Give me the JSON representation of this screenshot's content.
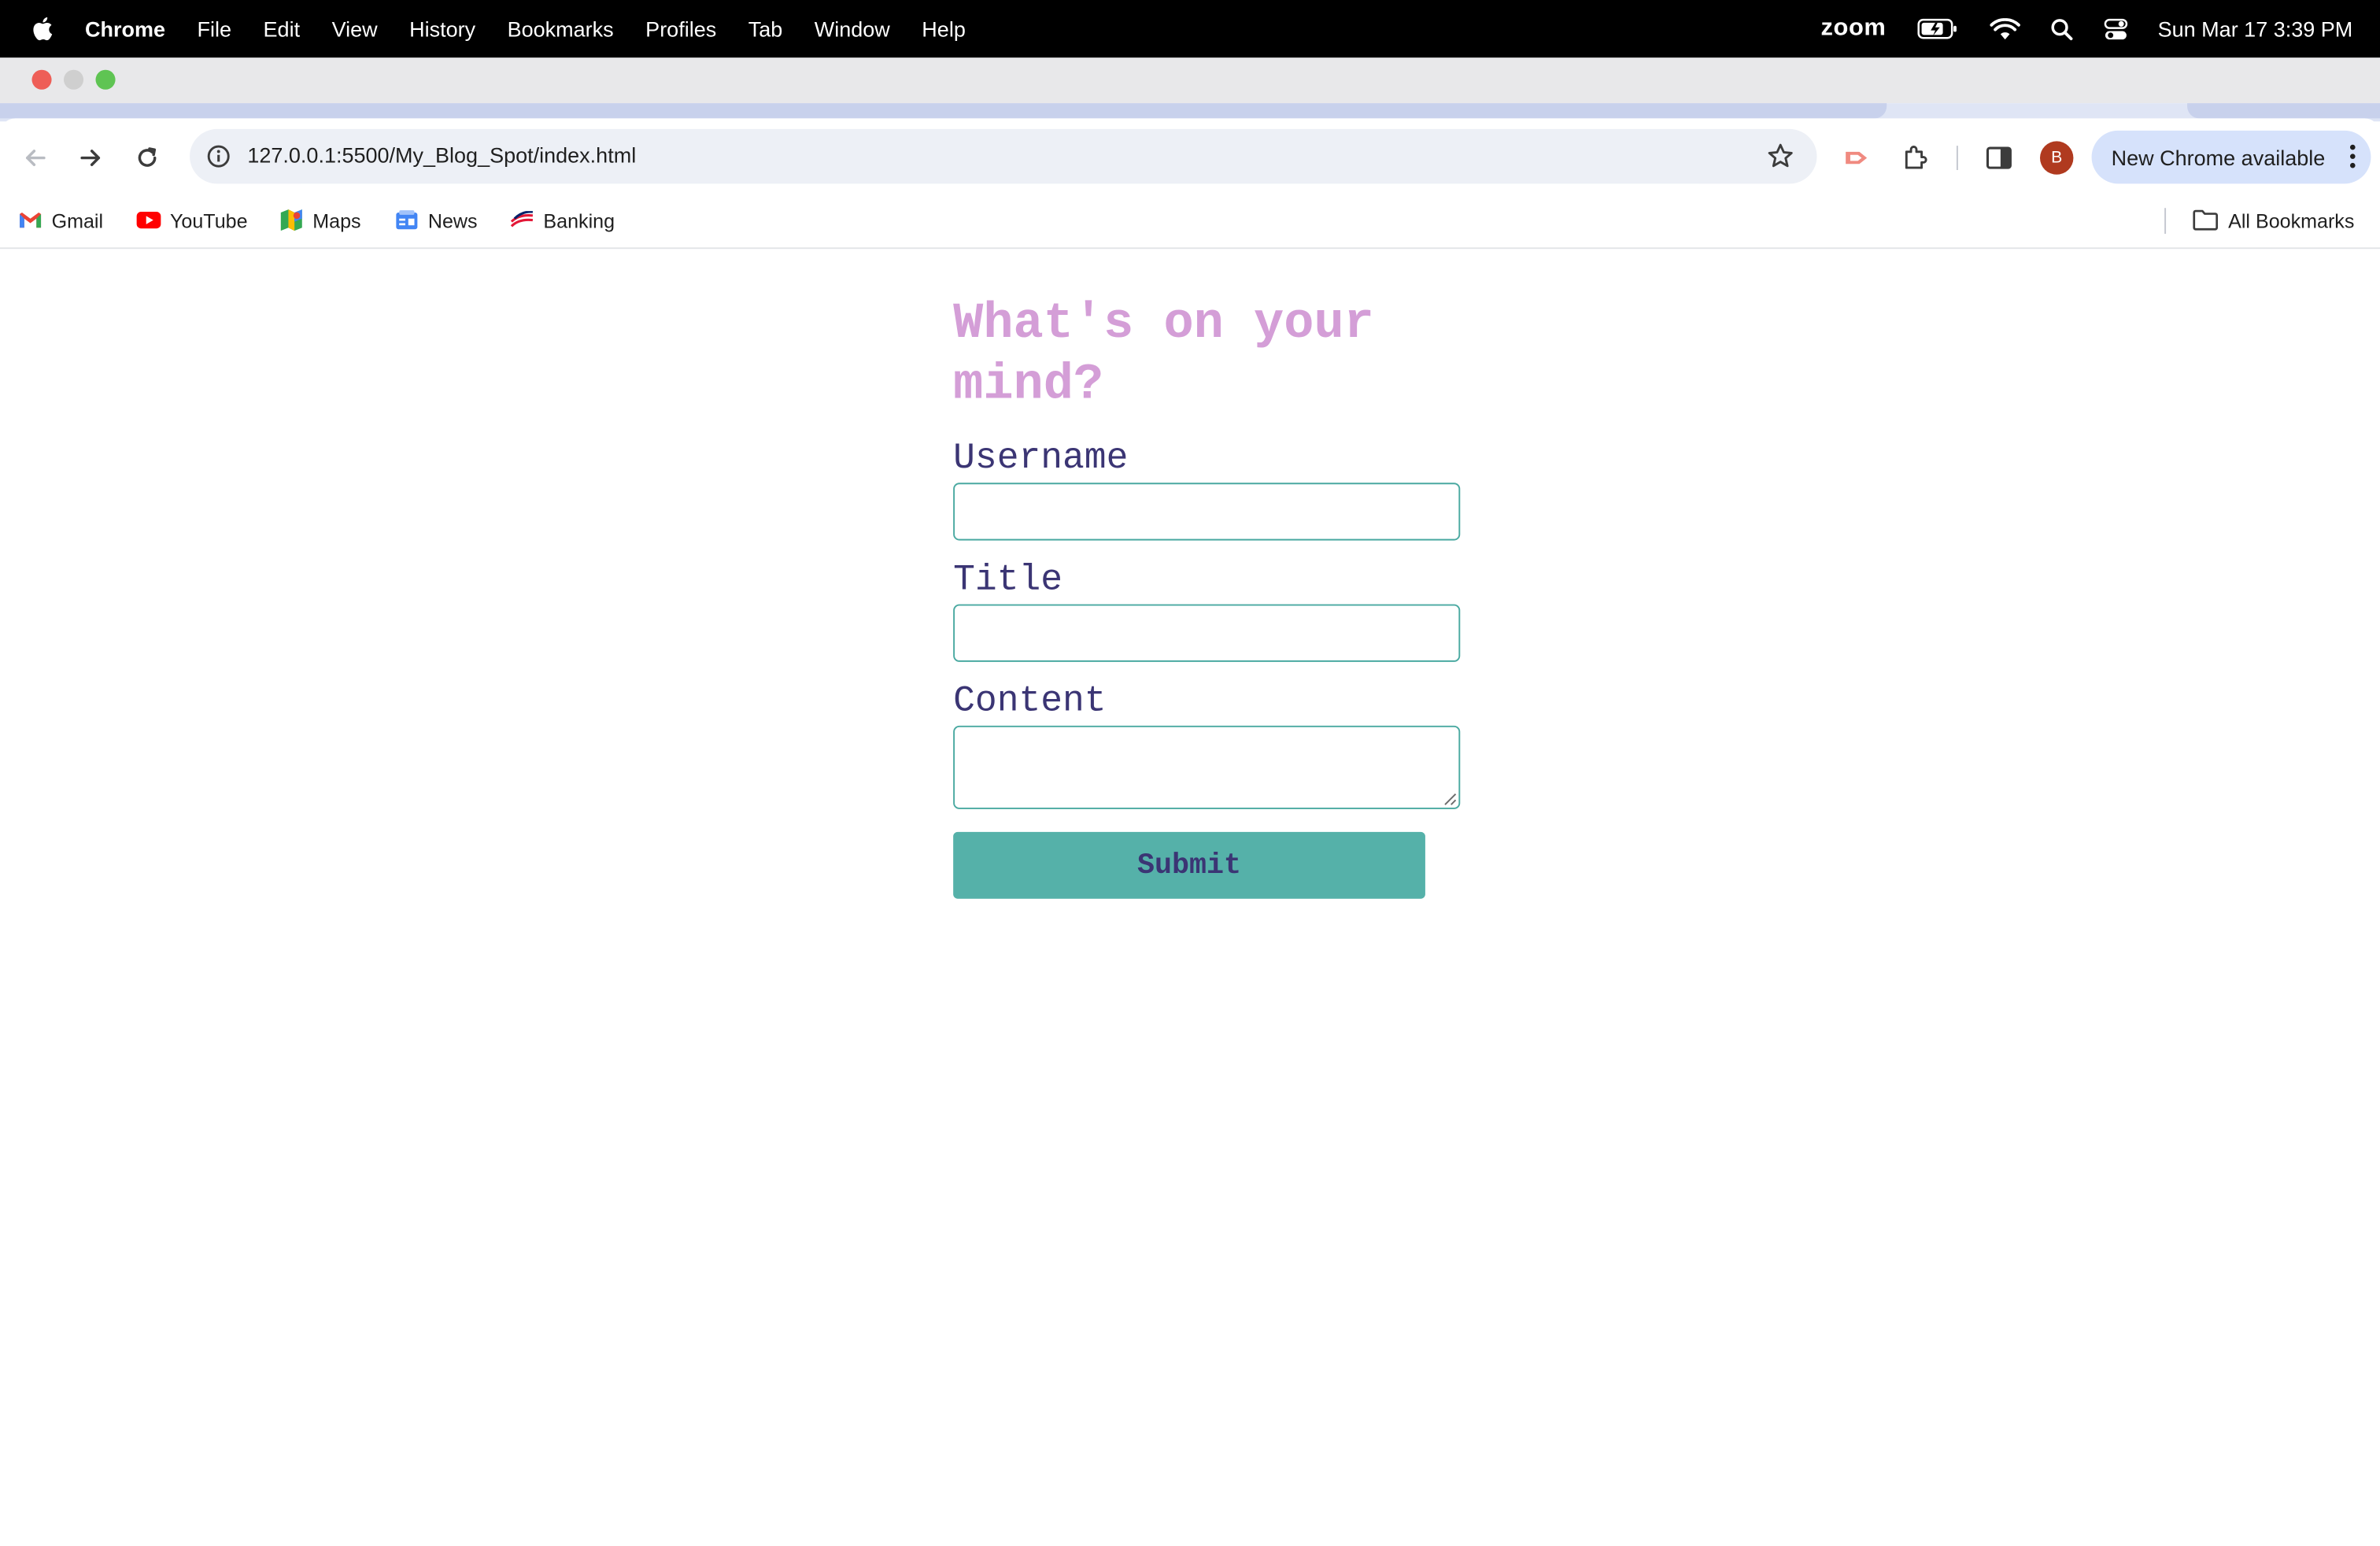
{
  "menubar": {
    "app_name": "Chrome",
    "menus": [
      "File",
      "Edit",
      "View",
      "History",
      "Bookmarks",
      "Profiles",
      "Tab",
      "Window",
      "Help"
    ],
    "zoom_label": "zoom",
    "clock": "Sun Mar 17  3:39 PM"
  },
  "browser": {
    "url": "127.0.0.1:5500/My_Blog_Spot/index.html",
    "avatar_letter": "B",
    "update_label": "New Chrome available",
    "bookmarks": [
      "Gmail",
      "YouTube",
      "Maps",
      "News",
      "Banking"
    ],
    "all_bookmarks_label": "All Bookmarks"
  },
  "form": {
    "heading": "What's on your mind?",
    "username_label": "Username",
    "username_value": "",
    "title_label": "Title",
    "title_value": "",
    "content_label": "Content",
    "content_value": "",
    "submit_label": "Submit"
  },
  "colors": {
    "heading": "#d49ed7",
    "label": "#3b3574",
    "field_border": "#4aa9a1",
    "button": "#55b1a9"
  }
}
